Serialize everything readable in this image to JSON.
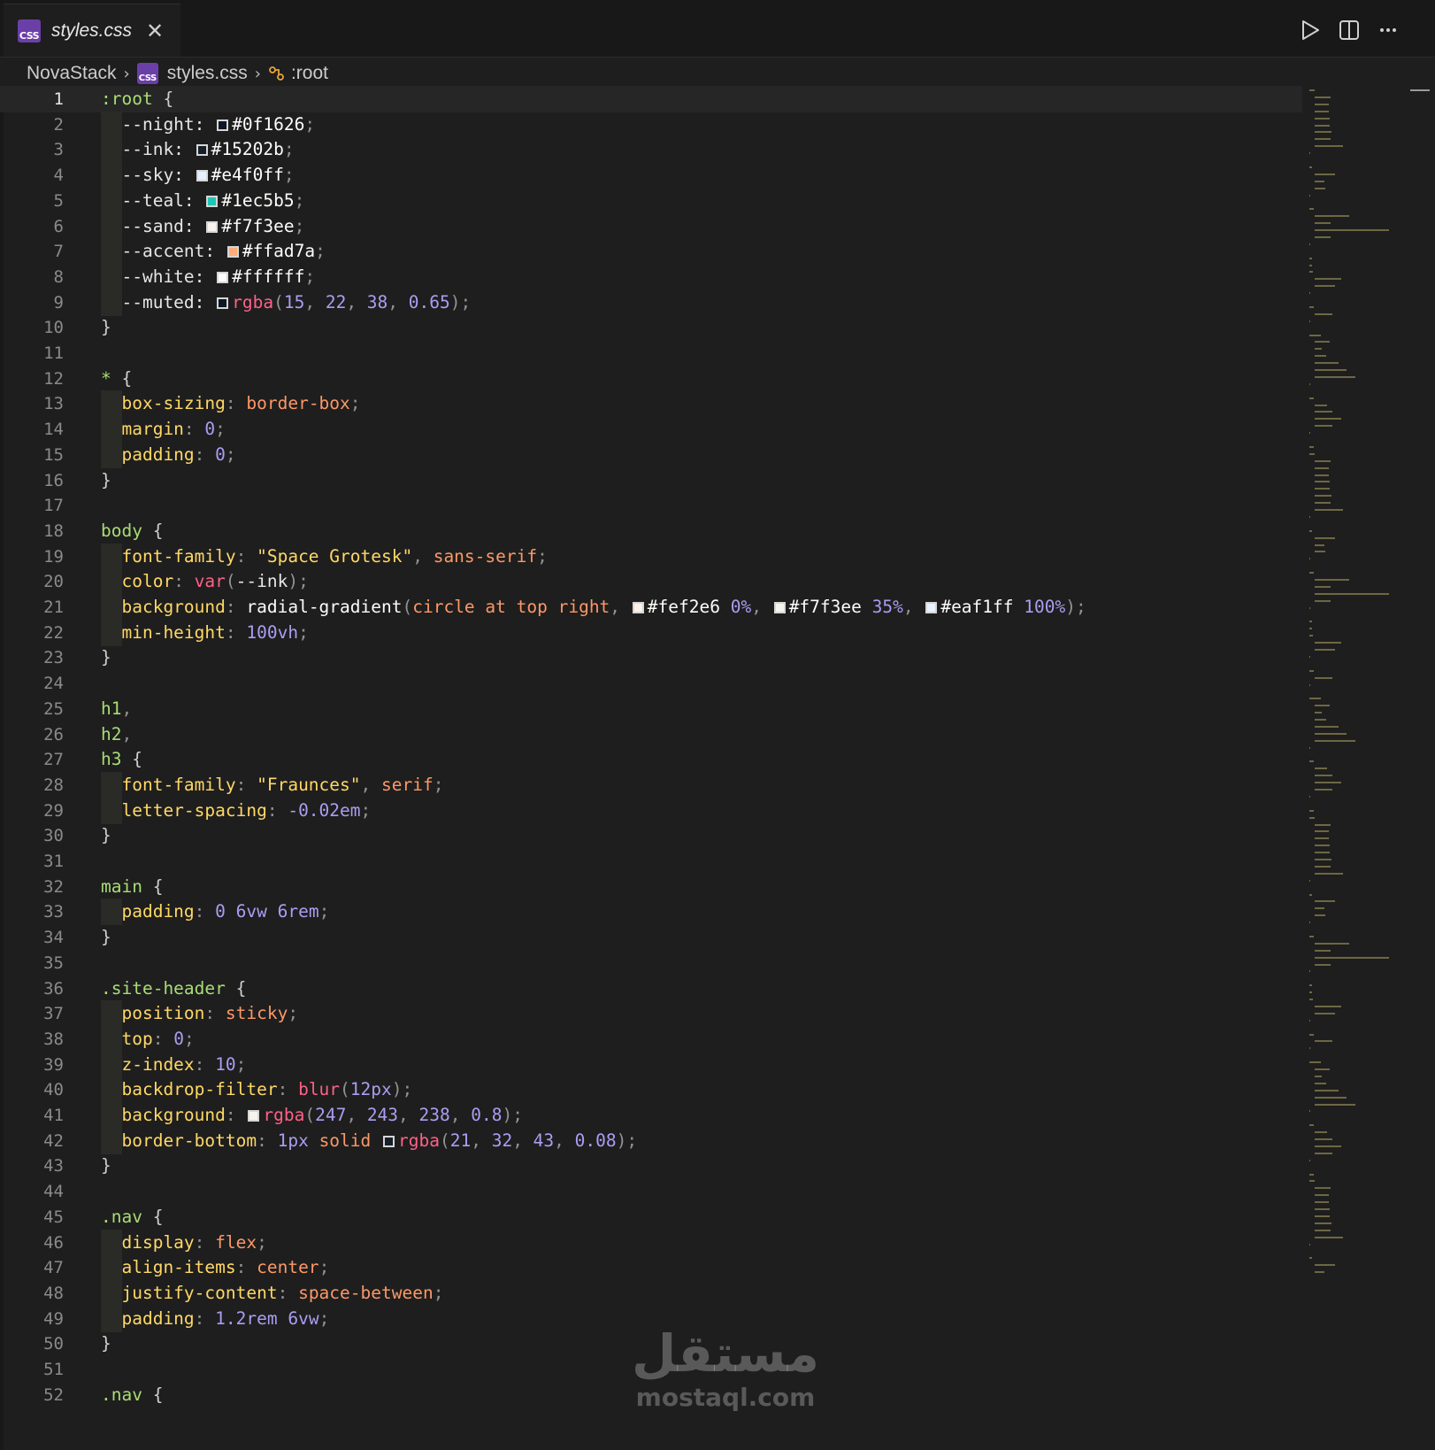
{
  "tab": {
    "label": "styles.css",
    "badge": "CSS"
  },
  "breadcrumb": {
    "project": "NovaStack",
    "file": "styles.css",
    "symbol": ":root"
  },
  "watermark": {
    "arabic": "مستقل",
    "latin": "mostaql.com"
  },
  "editor": {
    "active_line": 1,
    "lines": [
      [
        [
          "t-sel",
          ":root"
        ],
        [
          "t-brace",
          " {"
        ]
      ],
      [
        [
          "t-var",
          "  --night: "
        ],
        [
          "swatch",
          "#0f1626"
        ],
        [
          "t-hex",
          "#0f1626"
        ],
        [
          "t-punc",
          ";"
        ]
      ],
      [
        [
          "t-var",
          "  --ink: "
        ],
        [
          "swatch",
          "#15202b"
        ],
        [
          "t-hex",
          "#15202b"
        ],
        [
          "t-punc",
          ";"
        ]
      ],
      [
        [
          "t-var",
          "  --sky: "
        ],
        [
          "swatch",
          "#e4f0ff"
        ],
        [
          "t-hex",
          "#e4f0ff"
        ],
        [
          "t-punc",
          ";"
        ]
      ],
      [
        [
          "t-var",
          "  --teal: "
        ],
        [
          "swatch",
          "#1ec5b5"
        ],
        [
          "t-hex",
          "#1ec5b5"
        ],
        [
          "t-punc",
          ";"
        ]
      ],
      [
        [
          "t-var",
          "  --sand: "
        ],
        [
          "swatch",
          "#f7f3ee"
        ],
        [
          "t-hex",
          "#f7f3ee"
        ],
        [
          "t-punc",
          ";"
        ]
      ],
      [
        [
          "t-var",
          "  --accent: "
        ],
        [
          "swatch",
          "#ffad7a"
        ],
        [
          "t-hex",
          "#ffad7a"
        ],
        [
          "t-punc",
          ";"
        ]
      ],
      [
        [
          "t-var",
          "  --white: "
        ],
        [
          "swatch",
          "#ffffff"
        ],
        [
          "t-hex",
          "#ffffff"
        ],
        [
          "t-punc",
          ";"
        ]
      ],
      [
        [
          "t-var",
          "  --muted: "
        ],
        [
          "swatch",
          "#0f1626"
        ],
        [
          "t-fn",
          "rgba"
        ],
        [
          "t-punc",
          "("
        ],
        [
          "t-num",
          "15"
        ],
        [
          "t-punc",
          ", "
        ],
        [
          "t-num",
          "22"
        ],
        [
          "t-punc",
          ", "
        ],
        [
          "t-num",
          "38"
        ],
        [
          "t-punc",
          ", "
        ],
        [
          "t-num",
          "0.65"
        ],
        [
          "t-punc",
          ");"
        ]
      ],
      [
        [
          "t-brace",
          "}"
        ]
      ],
      [],
      [
        [
          "t-sel",
          "*"
        ],
        [
          "t-brace",
          " {"
        ]
      ],
      [
        [
          "t-prop",
          "  box-sizing"
        ],
        [
          "t-punc",
          ": "
        ],
        [
          "t-val",
          "border-box"
        ],
        [
          "t-punc",
          ";"
        ]
      ],
      [
        [
          "t-prop",
          "  margin"
        ],
        [
          "t-punc",
          ": "
        ],
        [
          "t-num",
          "0"
        ],
        [
          "t-punc",
          ";"
        ]
      ],
      [
        [
          "t-prop",
          "  padding"
        ],
        [
          "t-punc",
          ": "
        ],
        [
          "t-num",
          "0"
        ],
        [
          "t-punc",
          ";"
        ]
      ],
      [
        [
          "t-brace",
          "}"
        ]
      ],
      [],
      [
        [
          "t-sel",
          "body"
        ],
        [
          "t-brace",
          " {"
        ]
      ],
      [
        [
          "t-prop",
          "  font-family"
        ],
        [
          "t-punc",
          ": "
        ],
        [
          "t-str",
          "\"Space Grotesk\""
        ],
        [
          "t-punc",
          ", "
        ],
        [
          "t-val",
          "sans-serif"
        ],
        [
          "t-punc",
          ";"
        ]
      ],
      [
        [
          "t-prop",
          "  color"
        ],
        [
          "t-punc",
          ": "
        ],
        [
          "t-fn",
          "var"
        ],
        [
          "t-punc",
          "("
        ],
        [
          "t-var",
          "--ink"
        ],
        [
          "t-punc",
          ");"
        ]
      ],
      [
        [
          "t-prop",
          "  background"
        ],
        [
          "t-punc",
          ": "
        ],
        [
          "t-hex",
          "radial-gradient"
        ],
        [
          "t-punc",
          "("
        ],
        [
          "t-val",
          "circle at top right"
        ],
        [
          "t-punc",
          ", "
        ],
        [
          "swatch",
          "#fef2e6"
        ],
        [
          "t-hex",
          "#fef2e6"
        ],
        [
          "t-num",
          " 0%"
        ],
        [
          "t-punc",
          ", "
        ],
        [
          "swatch",
          "#f7f3ee"
        ],
        [
          "t-hex",
          "#f7f3ee"
        ],
        [
          "t-num",
          " 35%"
        ],
        [
          "t-punc",
          ", "
        ],
        [
          "swatch",
          "#eaf1ff"
        ],
        [
          "t-hex",
          "#eaf1ff"
        ],
        [
          "t-num",
          " 100%"
        ],
        [
          "t-punc",
          ");"
        ]
      ],
      [
        [
          "t-prop",
          "  min-height"
        ],
        [
          "t-punc",
          ": "
        ],
        [
          "t-num",
          "100vh"
        ],
        [
          "t-punc",
          ";"
        ]
      ],
      [
        [
          "t-brace",
          "}"
        ]
      ],
      [],
      [
        [
          "t-sel",
          "h1"
        ],
        [
          "t-punc",
          ","
        ]
      ],
      [
        [
          "t-sel",
          "h2"
        ],
        [
          "t-punc",
          ","
        ]
      ],
      [
        [
          "t-sel",
          "h3"
        ],
        [
          "t-brace",
          " {"
        ]
      ],
      [
        [
          "t-prop",
          "  font-family"
        ],
        [
          "t-punc",
          ": "
        ],
        [
          "t-str",
          "\"Fraunces\""
        ],
        [
          "t-punc",
          ", "
        ],
        [
          "t-val",
          "serif"
        ],
        [
          "t-punc",
          ";"
        ]
      ],
      [
        [
          "t-prop",
          "  letter-spacing"
        ],
        [
          "t-punc",
          ": "
        ],
        [
          "t-num",
          "-0.02em"
        ],
        [
          "t-punc",
          ";"
        ]
      ],
      [
        [
          "t-brace",
          "}"
        ]
      ],
      [],
      [
        [
          "t-sel",
          "main"
        ],
        [
          "t-brace",
          " {"
        ]
      ],
      [
        [
          "t-prop",
          "  padding"
        ],
        [
          "t-punc",
          ": "
        ],
        [
          "t-num",
          "0 6vw 6rem"
        ],
        [
          "t-punc",
          ";"
        ]
      ],
      [
        [
          "t-brace",
          "}"
        ]
      ],
      [],
      [
        [
          "t-sel",
          ".site-header"
        ],
        [
          "t-brace",
          " {"
        ]
      ],
      [
        [
          "t-prop",
          "  position"
        ],
        [
          "t-punc",
          ": "
        ],
        [
          "t-val",
          "sticky"
        ],
        [
          "t-punc",
          ";"
        ]
      ],
      [
        [
          "t-prop",
          "  top"
        ],
        [
          "t-punc",
          ": "
        ],
        [
          "t-num",
          "0"
        ],
        [
          "t-punc",
          ";"
        ]
      ],
      [
        [
          "t-prop",
          "  z-index"
        ],
        [
          "t-punc",
          ": "
        ],
        [
          "t-num",
          "10"
        ],
        [
          "t-punc",
          ";"
        ]
      ],
      [
        [
          "t-prop",
          "  backdrop-filter"
        ],
        [
          "t-punc",
          ": "
        ],
        [
          "t-fn",
          "blur"
        ],
        [
          "t-punc",
          "("
        ],
        [
          "t-num",
          "12px"
        ],
        [
          "t-punc",
          ");"
        ]
      ],
      [
        [
          "t-prop",
          "  background"
        ],
        [
          "t-punc",
          ": "
        ],
        [
          "swatch",
          "#f7f3ee"
        ],
        [
          "t-fn",
          "rgba"
        ],
        [
          "t-punc",
          "("
        ],
        [
          "t-num",
          "247"
        ],
        [
          "t-punc",
          ", "
        ],
        [
          "t-num",
          "243"
        ],
        [
          "t-punc",
          ", "
        ],
        [
          "t-num",
          "238"
        ],
        [
          "t-punc",
          ", "
        ],
        [
          "t-num",
          "0.8"
        ],
        [
          "t-punc",
          ");"
        ]
      ],
      [
        [
          "t-prop",
          "  border-bottom"
        ],
        [
          "t-punc",
          ": "
        ],
        [
          "t-num",
          "1px"
        ],
        [
          "t-val",
          " solid "
        ],
        [
          "swatch",
          "#15202b"
        ],
        [
          "t-fn",
          "rgba"
        ],
        [
          "t-punc",
          "("
        ],
        [
          "t-num",
          "21"
        ],
        [
          "t-punc",
          ", "
        ],
        [
          "t-num",
          "32"
        ],
        [
          "t-punc",
          ", "
        ],
        [
          "t-num",
          "43"
        ],
        [
          "t-punc",
          ", "
        ],
        [
          "t-num",
          "0.08"
        ],
        [
          "t-punc",
          ");"
        ]
      ],
      [
        [
          "t-brace",
          "}"
        ]
      ],
      [],
      [
        [
          "t-sel",
          ".nav"
        ],
        [
          "t-brace",
          " {"
        ]
      ],
      [
        [
          "t-prop",
          "  display"
        ],
        [
          "t-punc",
          ": "
        ],
        [
          "t-val",
          "flex"
        ],
        [
          "t-punc",
          ";"
        ]
      ],
      [
        [
          "t-prop",
          "  align-items"
        ],
        [
          "t-punc",
          ": "
        ],
        [
          "t-val",
          "center"
        ],
        [
          "t-punc",
          ";"
        ]
      ],
      [
        [
          "t-prop",
          "  justify-content"
        ],
        [
          "t-punc",
          ": "
        ],
        [
          "t-val",
          "space-between"
        ],
        [
          "t-punc",
          ";"
        ]
      ],
      [
        [
          "t-prop",
          "  padding"
        ],
        [
          "t-punc",
          ": "
        ],
        [
          "t-num",
          "1.2rem 6vw"
        ],
        [
          "t-punc",
          ";"
        ]
      ],
      [
        [
          "t-brace",
          "}"
        ]
      ],
      [],
      [
        [
          "t-sel",
          ".nav"
        ],
        [
          "t-brace",
          " {"
        ]
      ]
    ]
  }
}
